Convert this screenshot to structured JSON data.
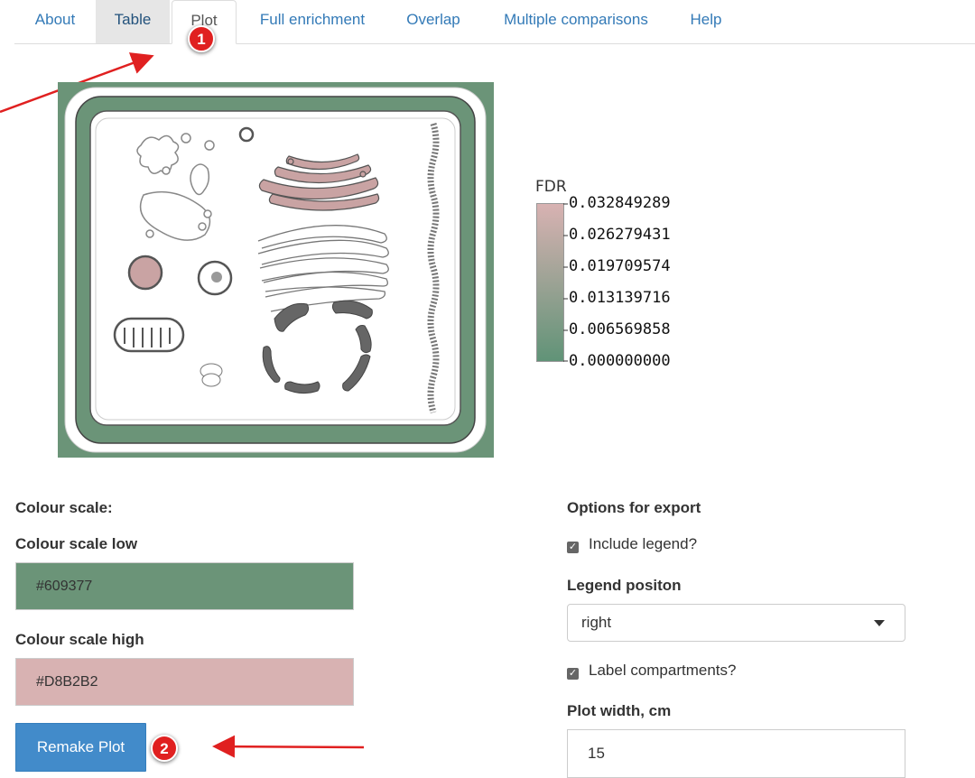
{
  "tabs": [
    {
      "label": "About"
    },
    {
      "label": "Table"
    },
    {
      "label": "Plot"
    },
    {
      "label": "Full enrichment"
    },
    {
      "label": "Overlap"
    },
    {
      "label": "Multiple comparisons"
    },
    {
      "label": "Help"
    }
  ],
  "annotations": {
    "badge1": "1",
    "badge2": "2",
    "arrow_color": "#e02020"
  },
  "legend": {
    "title": "FDR",
    "ticks": [
      "0.032849289",
      "0.026279431",
      "0.019709574",
      "0.013139716",
      "0.006569858",
      "0.000000000"
    ],
    "low_color": "#609377",
    "high_color": "#D8B2B2"
  },
  "form": {
    "colour_scale_heading": "Colour scale:",
    "colour_low_label": "Colour scale low",
    "colour_low_value": "#609377",
    "colour_high_label": "Colour scale high",
    "colour_high_value": "#D8B2B2",
    "remake_button": "Remake Plot"
  },
  "export": {
    "heading": "Options for export",
    "include_legend_label": "Include legend?",
    "include_legend_checked": true,
    "legend_position_label": "Legend positon",
    "legend_position_value": "right",
    "label_compartments_label": "Label compartments?",
    "label_compartments_checked": true,
    "plot_width_label": "Plot width, cm",
    "plot_width_value": "15"
  }
}
